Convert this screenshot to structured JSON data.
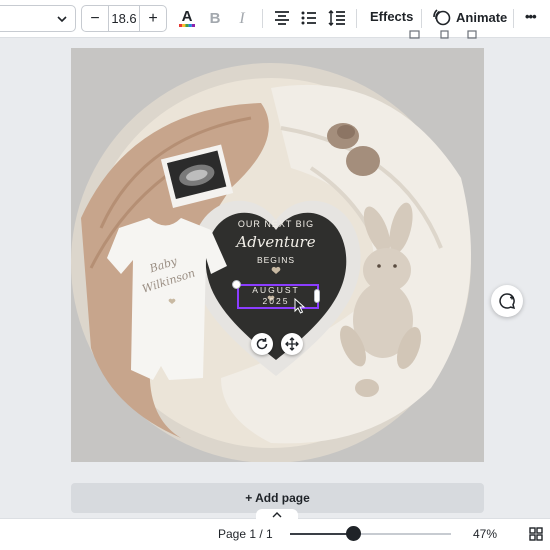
{
  "toolbar": {
    "font_size": "18.6",
    "decrease_label": "−",
    "increase_label": "+",
    "effects_label": "Effects",
    "animate_label": "Animate",
    "more_label": "•••",
    "icons": [
      "chevron-down-icon",
      "text-color-icon",
      "bold-icon",
      "italic-icon",
      "align-center-icon",
      "list-icon",
      "line-spacing-icon",
      "animate-icon",
      "more-icon"
    ],
    "text_color_bar": [
      "#e53935",
      "#fbc02d",
      "#43a047",
      "#1e88e5",
      "#8e24aa"
    ]
  },
  "design": {
    "letter_board": {
      "line1": "OUR NEXT BIG",
      "line2": "Adventure",
      "line3": "BEGINS",
      "line4": "AUGUST",
      "line5": "2025"
    },
    "onesie_text": {
      "line1": "Baby",
      "line2": "Wilkinson"
    },
    "selection_color": "#8b3dff"
  },
  "canvas": {
    "add_page_label": "+ Add page"
  },
  "bottom_bar": {
    "page_label": "Page 1 / 1",
    "zoom_label": "47%",
    "zoom_percent": 47
  }
}
